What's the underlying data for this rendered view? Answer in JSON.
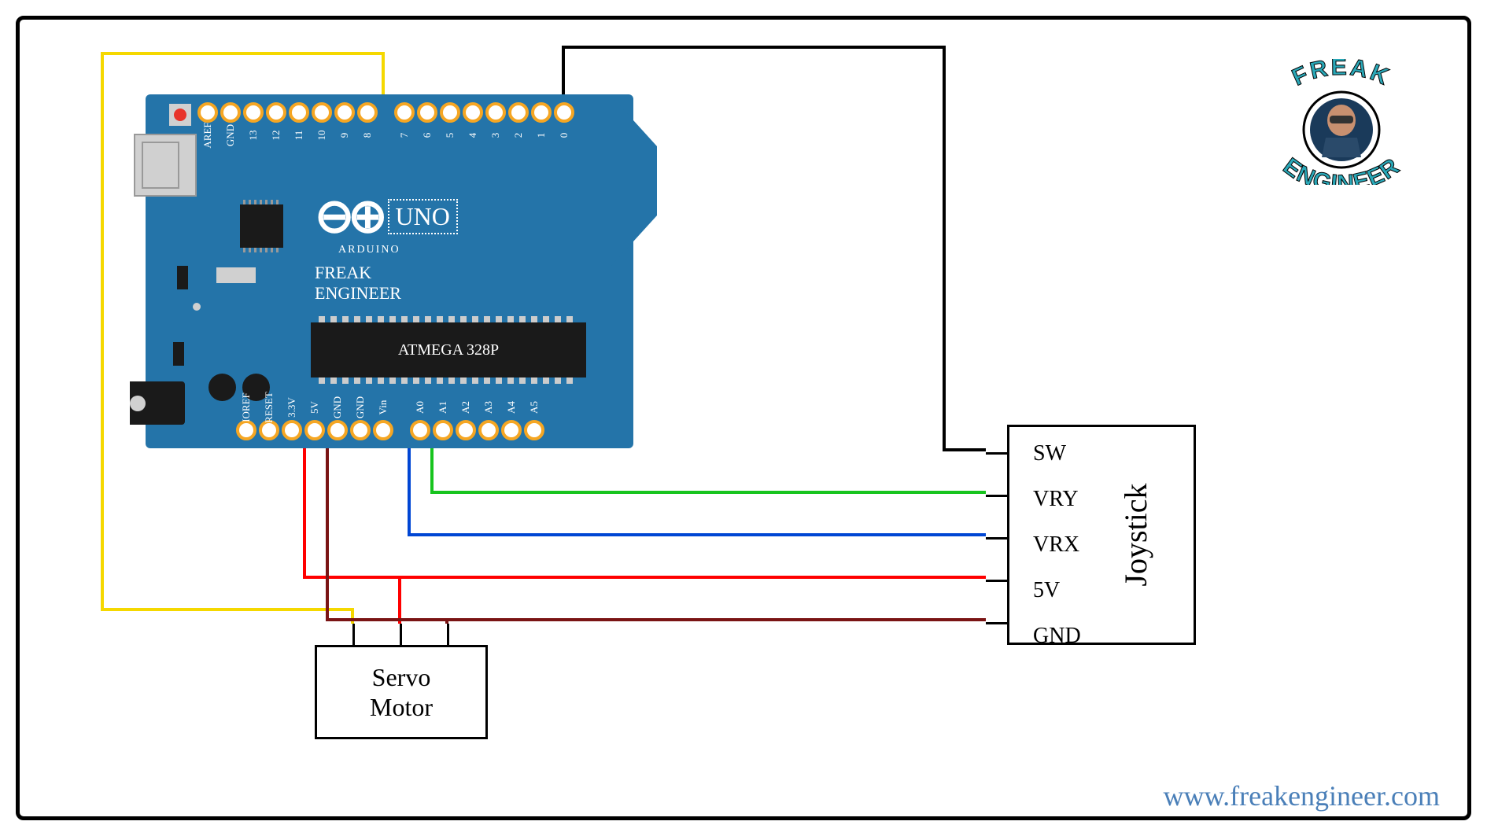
{
  "arduino": {
    "title_uno": "UNO",
    "title_arduino": "ARDUINO",
    "brand_line1": "FREAK",
    "brand_line2": "ENGINEER",
    "mcu_label": "ATMEGA 328P",
    "top_pins": [
      "AREF",
      "GND",
      "13",
      "12",
      "11",
      "10",
      "9",
      "8",
      "7",
      "6",
      "5",
      "4",
      "3",
      "2",
      "1",
      "0"
    ],
    "bottom_pins": [
      "IOREF",
      "RESET",
      "3.3V",
      "5V",
      "GND",
      "GND",
      "Vin",
      "A0",
      "A1",
      "A2",
      "A3",
      "A4",
      "A5"
    ]
  },
  "joystick": {
    "title": "Joystick",
    "pins": [
      "SW",
      "VRY",
      "VRX",
      "5V",
      "GND"
    ]
  },
  "servo": {
    "title": "Servo\nMotor"
  },
  "logo": {
    "text_top": "FREAK",
    "text_bottom": "ENGINEER"
  },
  "website": "www.freakengineer.com",
  "wires": {
    "digital9_to_servo": {
      "color": "#f5d800",
      "from": "Arduino D9",
      "to": "Servo signal"
    },
    "digital2_to_joystick_sw": {
      "color": "#000000",
      "from": "Arduino D2",
      "to": "Joystick SW"
    },
    "a0_to_joystick_vrx": {
      "color": "#0046d4",
      "from": "Arduino A0",
      "to": "Joystick VRX"
    },
    "a1_to_joystick_vry": {
      "color": "#17c41e",
      "from": "Arduino A1",
      "to": "Joystick VRY"
    },
    "5v_to_joystick": {
      "color": "#ff0000",
      "from": "Arduino 5V",
      "to": "Joystick 5V"
    },
    "5v_to_servo": {
      "color": "#ff0000",
      "from": "Arduino 5V",
      "to": "Servo VCC"
    },
    "gnd_to_joystick": {
      "color": "#7a1414",
      "from": "Arduino GND",
      "to": "Joystick GND"
    },
    "gnd_to_servo": {
      "color": "#7a1414",
      "from": "Arduino GND",
      "to": "Servo GND"
    }
  }
}
